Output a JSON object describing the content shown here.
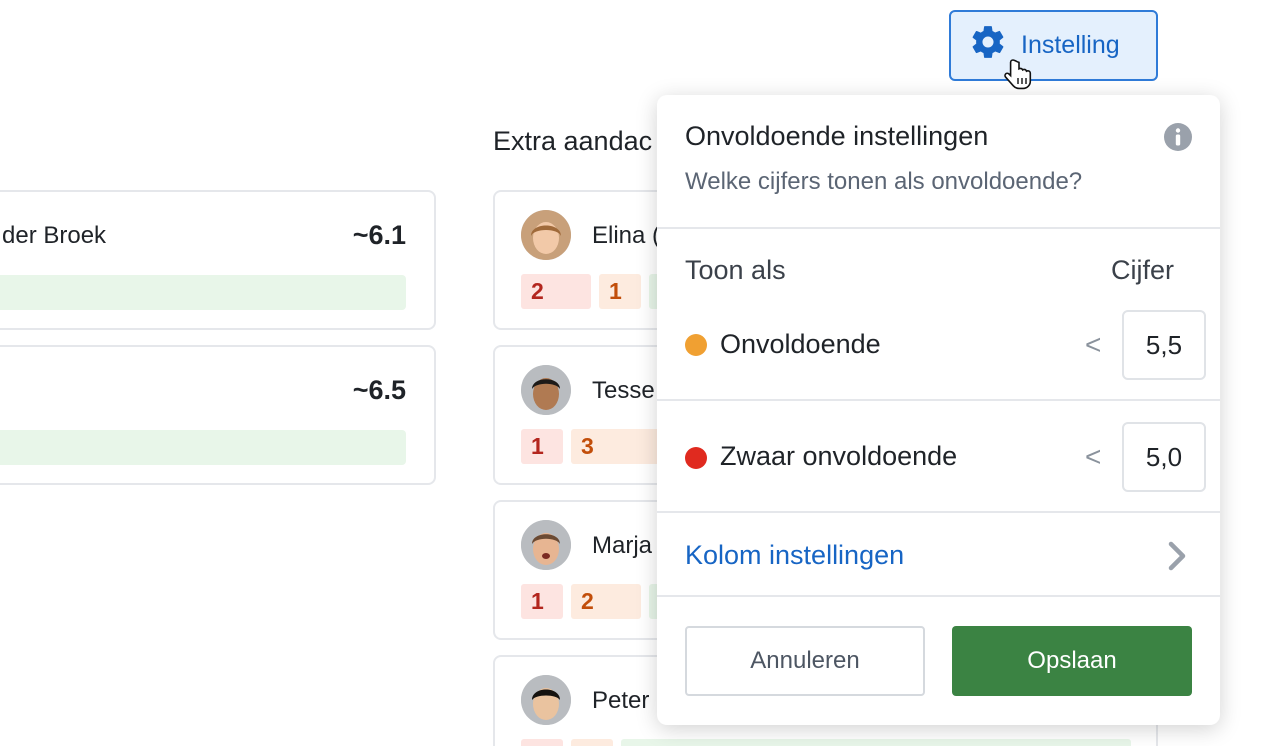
{
  "settings_button": {
    "label": "Instelling",
    "accent": "#1765c4"
  },
  "left_cards": [
    {
      "name": "der Broek",
      "average": "~6.1"
    },
    {
      "name": "",
      "average": "~6.5"
    }
  ],
  "section": {
    "title": "Extra aandac"
  },
  "students": [
    {
      "name": "Elina (",
      "chips": [
        {
          "value": "2",
          "kind": "red"
        },
        {
          "value": "1",
          "kind": "orange"
        }
      ]
    },
    {
      "name": "Tesse",
      "chips": [
        {
          "value": "1",
          "kind": "red"
        },
        {
          "value": "3",
          "kind": "orange"
        }
      ]
    },
    {
      "name": "Marja",
      "chips": [
        {
          "value": "1",
          "kind": "red"
        },
        {
          "value": "2",
          "kind": "orange"
        }
      ]
    },
    {
      "name": "Peter",
      "chips": []
    }
  ],
  "popover": {
    "title": "Onvoldoende instellingen",
    "subtitle": "Welke cijfers tonen als onvoldoende?",
    "col_show_as": "Toon als",
    "col_grade": "Cijfer",
    "rows": [
      {
        "label": "Onvoldoende",
        "op": "<",
        "value": "5,5",
        "color": "#f0a032"
      },
      {
        "label": "Zwaar onvoldoende",
        "op": "<",
        "value": "5,0",
        "color": "#e02a1f"
      }
    ],
    "column_settings_link": "Kolom instellingen",
    "cancel_label": "Annuleren",
    "save_label": "Opslaan"
  }
}
